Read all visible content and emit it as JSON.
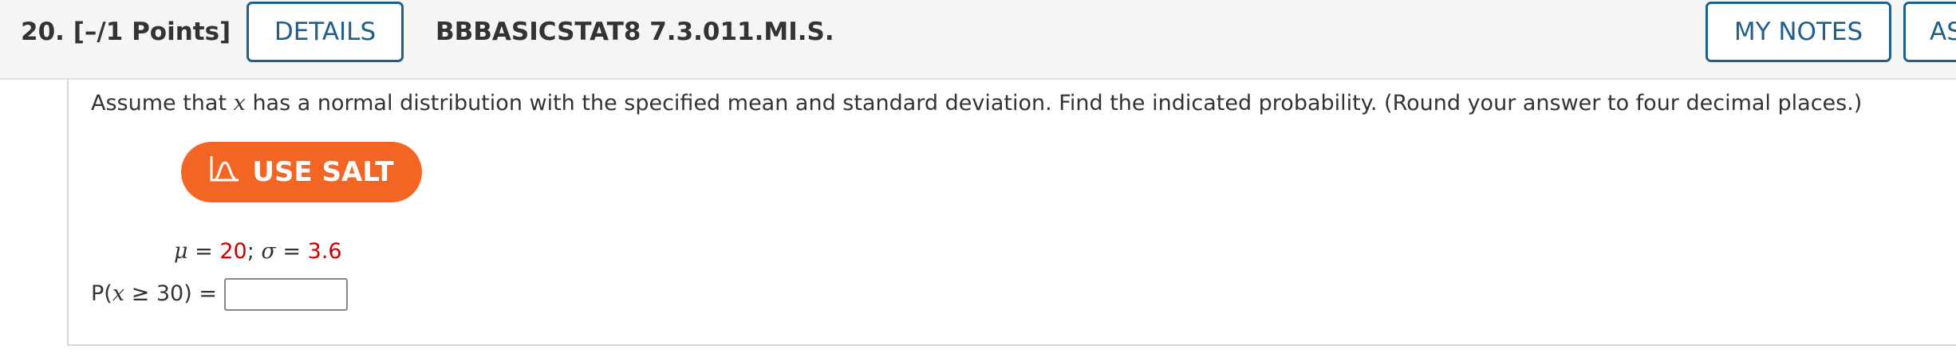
{
  "header": {
    "question_number": "20.",
    "points": "[–/1 Points]",
    "details_label": "DETAILS",
    "question_id": "BBBASICSTAT8 7.3.011.MI.S.",
    "my_notes_label": "MY NOTES",
    "ask_label": "AS"
  },
  "question": {
    "text_before": "Assume that ",
    "variable": "x",
    "text_after": " has a normal distribution with the specified mean and standard deviation. Find the indicated probability. (Round your answer to four decimal places.)"
  },
  "salt": {
    "label": "USE SALT",
    "icon": "salt-distribution-icon"
  },
  "params": {
    "mu_symbol": "μ",
    "mu_value": "20",
    "sigma_symbol": "σ",
    "sigma_value": "3.6",
    "equals": " = ",
    "separator": "; "
  },
  "probability": {
    "prefix": "P(",
    "var": "x",
    "condition": " ≥ 30) =",
    "answer_value": ""
  },
  "colors": {
    "accent": "#1e5f8c",
    "salt": "#f26522",
    "value_red": "#cc0000"
  }
}
